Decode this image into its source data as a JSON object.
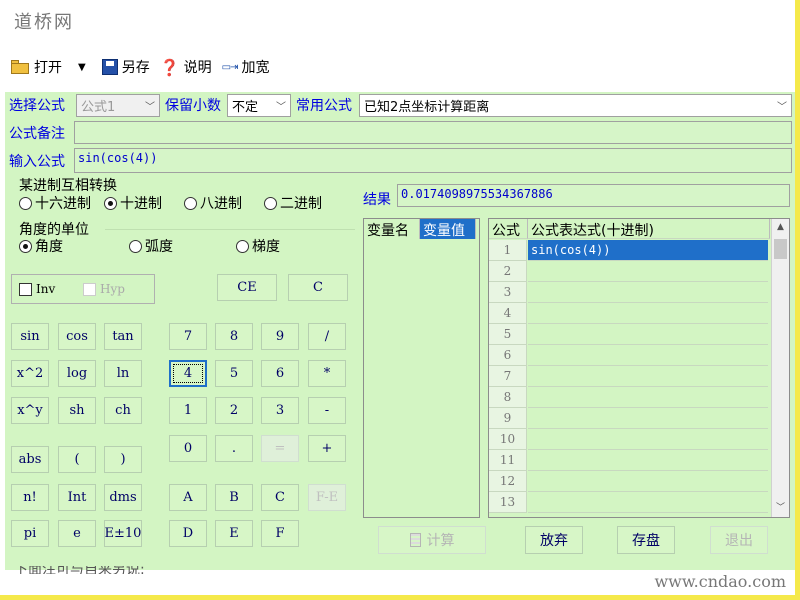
{
  "window": {
    "title": "道桥网"
  },
  "toolbar": {
    "open_label": "打开",
    "dropdown_glyph": "▼",
    "saveas_label": "另存",
    "help_label": "说明",
    "widen_label": "加宽"
  },
  "formula_row": {
    "select_label": "选择公式",
    "select_value": "公式1",
    "decimals_label": "保留小数",
    "decimals_value": "不定",
    "common_label": "常用公式",
    "common_value": "已知2点坐标计算距离"
  },
  "note": {
    "label": "公式备注",
    "value": ""
  },
  "input": {
    "label": "输入公式",
    "value": "sin(cos(4))"
  },
  "base": {
    "title": "某进制互相转换",
    "options": [
      "十六进制",
      "十进制",
      "八进制",
      "二进制"
    ],
    "selected": 1
  },
  "angle": {
    "title": "角度的单位",
    "options": [
      "角度",
      "弧度",
      "梯度"
    ],
    "selected": 0
  },
  "checks": {
    "inv": "Inv",
    "hyp": "Hyp"
  },
  "buttons": {
    "ce": "CE",
    "c": "C",
    "sin": "sin",
    "cos": "cos",
    "tan": "tan",
    "x2": "x^2",
    "log": "log",
    "ln": "ln",
    "xy": "x^y",
    "sh": "sh",
    "ch": "ch",
    "abs": "abs",
    "lparen": "(",
    "rparen": ")",
    "fact": "n!",
    "int": "Int",
    "dms": "dms",
    "pi": "pi",
    "e": "e",
    "e10": "E±10",
    "n7": "7",
    "n8": "8",
    "n9": "9",
    "div": "/",
    "n4": "4",
    "n5": "5",
    "n6": "6",
    "mul": "*",
    "n1": "1",
    "n2": "2",
    "n3": "3",
    "sub": "-",
    "n0": "0",
    "dot": ".",
    "eq": "=",
    "add": "+",
    "hA": "A",
    "hB": "B",
    "hC": "C",
    "fe": "F-E",
    "hD": "D",
    "hE": "E",
    "hF": "F"
  },
  "result": {
    "label": "结果",
    "value": "0.0174098975534367886"
  },
  "vars": {
    "col_name": "变量名",
    "col_value": "变量值"
  },
  "grid": {
    "col_no": "公式",
    "col_expr": "公式表达式(十进制)",
    "rows": [
      {
        "n": "1",
        "expr": "sin(cos(4))"
      },
      {
        "n": "2",
        "expr": ""
      },
      {
        "n": "3",
        "expr": ""
      },
      {
        "n": "4",
        "expr": ""
      },
      {
        "n": "5",
        "expr": ""
      },
      {
        "n": "6",
        "expr": ""
      },
      {
        "n": "7",
        "expr": ""
      },
      {
        "n": "8",
        "expr": ""
      },
      {
        "n": "9",
        "expr": ""
      },
      {
        "n": "10",
        "expr": ""
      },
      {
        "n": "11",
        "expr": ""
      },
      {
        "n": "12",
        "expr": ""
      },
      {
        "n": "13",
        "expr": ""
      }
    ]
  },
  "actions": {
    "calc": "计算",
    "discard": "放弃",
    "save": "存盘",
    "exit": "退出"
  },
  "footer": {
    "partial_text": "下面注可与自来另说:",
    "watermark": "www.cndao.com"
  }
}
